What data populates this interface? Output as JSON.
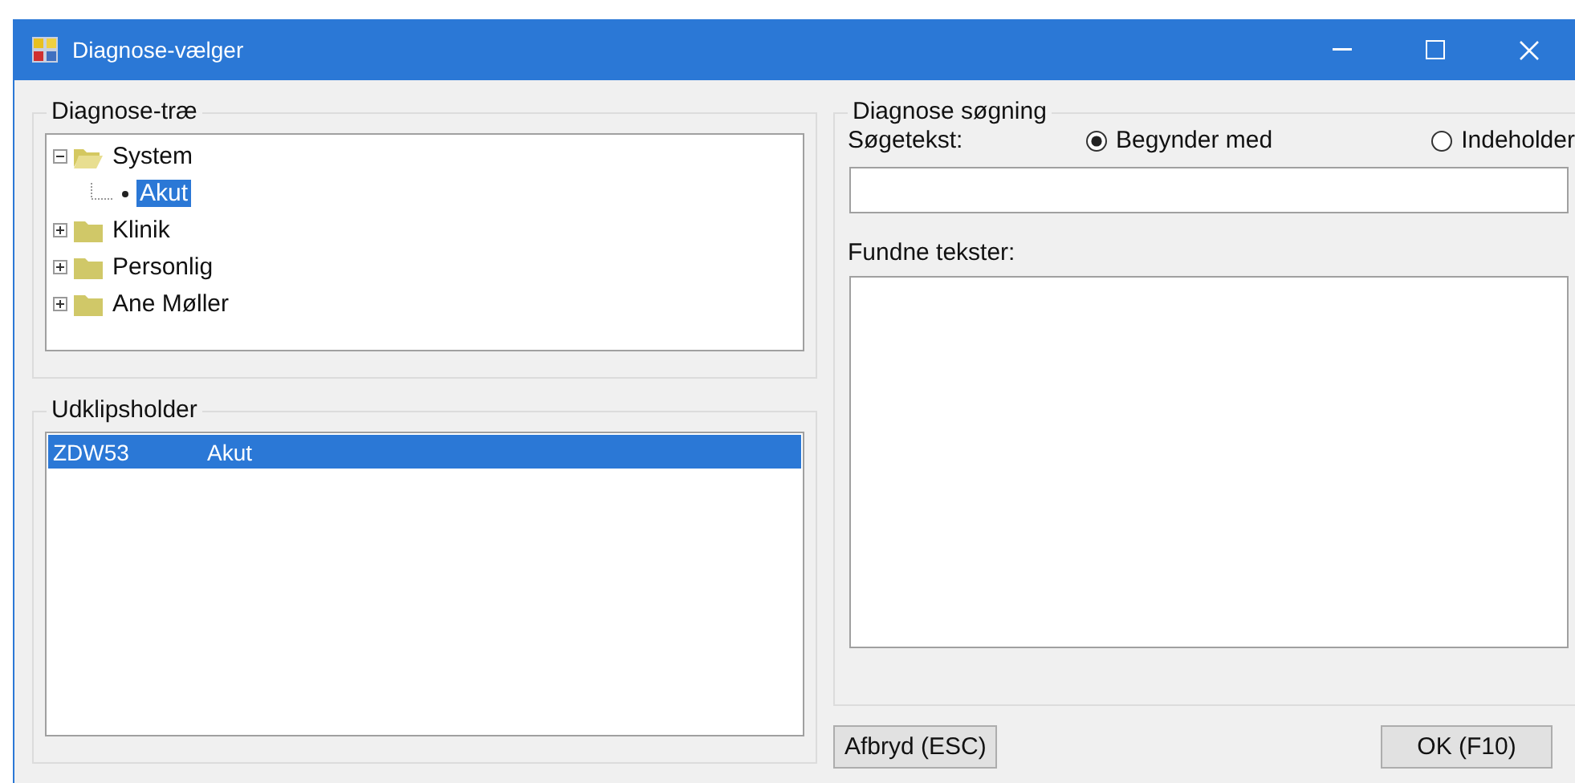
{
  "window": {
    "title": "Diagnose-vælger"
  },
  "diagnosis_tree": {
    "title": "Diagnose-træ",
    "nodes": [
      {
        "label": "System",
        "expanded": true,
        "selected": false,
        "children": [
          {
            "label": "Akut",
            "selected": true
          }
        ]
      },
      {
        "label": "Klinik",
        "expanded": false,
        "selected": false
      },
      {
        "label": "Personlig",
        "expanded": false,
        "selected": false
      },
      {
        "label": "Ane Møller",
        "expanded": false,
        "selected": false
      }
    ]
  },
  "clipboard": {
    "title": "Udklipsholder",
    "rows": [
      {
        "code": "ZDW53",
        "text": "Akut",
        "selected": true
      }
    ]
  },
  "search": {
    "title": "Diagnose søgning",
    "label": "Søgetekst:",
    "modes": [
      {
        "label": "Begynder med",
        "selected": true
      },
      {
        "label": "Indeholder",
        "selected": false
      }
    ],
    "results_label": "Fundne tekster:"
  },
  "buttons": [
    {
      "label": "Afbryd (ESC)"
    },
    {
      "label": "OK (F10)"
    }
  ]
}
